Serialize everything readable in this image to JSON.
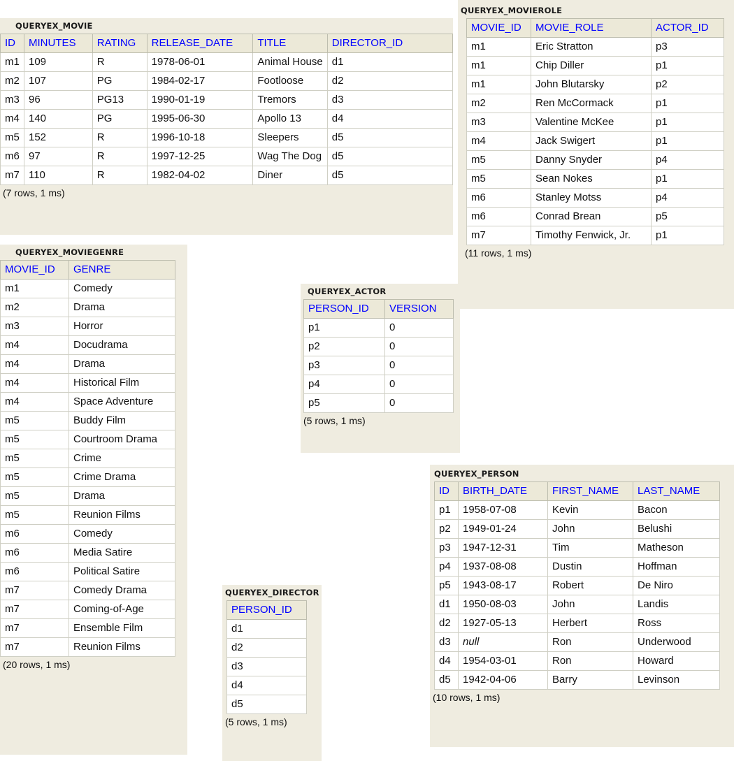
{
  "theme": {
    "page_background": "#ffffff",
    "panel_background": "#efece0",
    "header_background": "#ece9d8",
    "header_text_color": "#0000ff",
    "cell_background": "#ffffff",
    "cell_text_color": "#111111",
    "border_color": "#cfcfc4"
  },
  "tables": {
    "movie": {
      "title": "QUERYEX_MOVIE",
      "columns": [
        "ID",
        "MINUTES",
        "RATING",
        "RELEASE_DATE",
        "TITLE",
        "DIRECTOR_ID"
      ],
      "rows": [
        [
          "m1",
          "109",
          "R",
          "1978-06-01",
          "Animal House",
          "d1"
        ],
        [
          "m2",
          "107",
          "PG",
          "1984-02-17",
          "Footloose",
          "d2"
        ],
        [
          "m3",
          "96",
          "PG13",
          "1990-01-19",
          "Tremors",
          "d3"
        ],
        [
          "m4",
          "140",
          "PG",
          "1995-06-30",
          "Apollo 13",
          "d4"
        ],
        [
          "m5",
          "152",
          "R",
          "1996-10-18",
          "Sleepers",
          "d5"
        ],
        [
          "m6",
          "97",
          "R",
          "1997-12-25",
          "Wag The Dog",
          "d5"
        ],
        [
          "m7",
          "110",
          "R",
          "1982-04-02",
          "Diner",
          "d5"
        ]
      ],
      "footer": "(7 rows, 1 ms)"
    },
    "movierole": {
      "title": "QUERYEX_MOVIEROLE",
      "columns": [
        "MOVIE_ID",
        "MOVIE_ROLE",
        "ACTOR_ID"
      ],
      "rows": [
        [
          "m1",
          "Eric Stratton",
          "p3"
        ],
        [
          "m1",
          "Chip Diller",
          "p1"
        ],
        [
          "m1",
          "John Blutarsky",
          "p2"
        ],
        [
          "m2",
          "Ren McCormack",
          "p1"
        ],
        [
          "m3",
          "Valentine McKee",
          "p1"
        ],
        [
          "m4",
          "Jack Swigert",
          "p1"
        ],
        [
          "m5",
          "Danny Snyder",
          "p4"
        ],
        [
          "m5",
          "Sean Nokes",
          "p1"
        ],
        [
          "m6",
          "Stanley Motss",
          "p4"
        ],
        [
          "m6",
          "Conrad Brean",
          "p5"
        ],
        [
          "m7",
          "Timothy Fenwick, Jr.",
          "p1"
        ]
      ],
      "footer": "(11 rows, 1 ms)"
    },
    "moviegenre": {
      "title": "QUERYEX_MOVIEGENRE",
      "columns": [
        "MOVIE_ID",
        "GENRE"
      ],
      "rows": [
        [
          "m1",
          "Comedy"
        ],
        [
          "m2",
          "Drama"
        ],
        [
          "m3",
          "Horror"
        ],
        [
          "m4",
          "Docudrama"
        ],
        [
          "m4",
          "Drama"
        ],
        [
          "m4",
          "Historical Film"
        ],
        [
          "m4",
          "Space Adventure"
        ],
        [
          "m5",
          "Buddy Film"
        ],
        [
          "m5",
          "Courtroom Drama"
        ],
        [
          "m5",
          "Crime"
        ],
        [
          "m5",
          "Crime Drama"
        ],
        [
          "m5",
          "Drama"
        ],
        [
          "m5",
          "Reunion Films"
        ],
        [
          "m6",
          "Comedy"
        ],
        [
          "m6",
          "Media Satire"
        ],
        [
          "m6",
          "Political Satire"
        ],
        [
          "m7",
          "Comedy Drama"
        ],
        [
          "m7",
          "Coming-of-Age"
        ],
        [
          "m7",
          "Ensemble Film"
        ],
        [
          "m7",
          "Reunion Films"
        ]
      ],
      "footer": "(20 rows, 1 ms)"
    },
    "actor": {
      "title": "QUERYEX_ACTOR",
      "columns": [
        "PERSON_ID",
        "VERSION"
      ],
      "rows": [
        [
          "p1",
          "0"
        ],
        [
          "p2",
          "0"
        ],
        [
          "p3",
          "0"
        ],
        [
          "p4",
          "0"
        ],
        [
          "p5",
          "0"
        ]
      ],
      "footer": "(5 rows, 1 ms)"
    },
    "person": {
      "title": "QUERYEX_PERSON",
      "columns": [
        "ID",
        "BIRTH_DATE",
        "FIRST_NAME",
        "LAST_NAME"
      ],
      "rows": [
        [
          "p1",
          "1958-07-08",
          "Kevin",
          "Bacon"
        ],
        [
          "p2",
          "1949-01-24",
          "John",
          "Belushi"
        ],
        [
          "p3",
          "1947-12-31",
          "Tim",
          "Matheson"
        ],
        [
          "p4",
          "1937-08-08",
          "Dustin",
          "Hoffman"
        ],
        [
          "p5",
          "1943-08-17",
          "Robert",
          "De Niro"
        ],
        [
          "d1",
          "1950-08-03",
          "John",
          "Landis"
        ],
        [
          "d2",
          "1927-05-13",
          "Herbert",
          "Ross"
        ],
        [
          "d3",
          "null",
          "Ron",
          "Underwood"
        ],
        [
          "d4",
          "1954-03-01",
          "Ron",
          "Howard"
        ],
        [
          "d5",
          "1942-04-06",
          "Barry",
          "Levinson"
        ]
      ],
      "null_cells": [
        [
          7,
          1
        ]
      ],
      "footer": "(10 rows, 1 ms)"
    },
    "director": {
      "title": "QUERYEX_DIRECTOR",
      "columns": [
        "PERSON_ID"
      ],
      "rows": [
        [
          "d1"
        ],
        [
          "d2"
        ],
        [
          "d3"
        ],
        [
          "d4"
        ],
        [
          "d5"
        ]
      ],
      "footer": "(5 rows, 1 ms)"
    }
  }
}
